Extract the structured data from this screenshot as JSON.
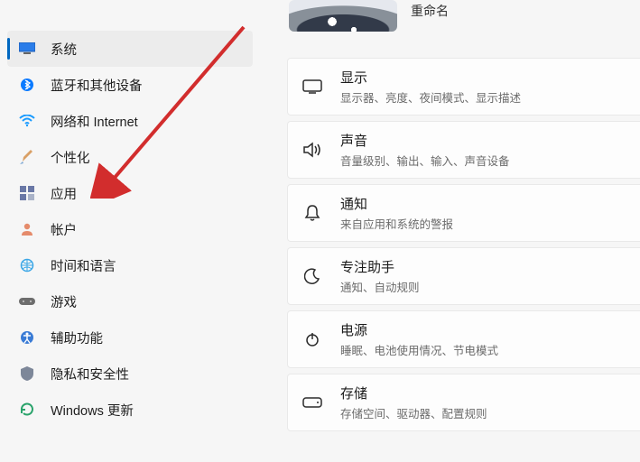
{
  "device": {
    "name": "",
    "rename_label": "重命名"
  },
  "sidebar": {
    "items": [
      {
        "label": "系统"
      },
      {
        "label": "蓝牙和其他设备"
      },
      {
        "label": "网络和 Internet"
      },
      {
        "label": "个性化"
      },
      {
        "label": "应用"
      },
      {
        "label": "帐户"
      },
      {
        "label": "时间和语言"
      },
      {
        "label": "游戏"
      },
      {
        "label": "辅助功能"
      },
      {
        "label": "隐私和安全性"
      },
      {
        "label": "Windows 更新"
      }
    ]
  },
  "main": {
    "cards": [
      {
        "title": "显示",
        "sub": "显示器、亮度、夜间模式、显示描述"
      },
      {
        "title": "声音",
        "sub": "音量级别、输出、输入、声音设备"
      },
      {
        "title": "通知",
        "sub": "来自应用和系统的警报"
      },
      {
        "title": "专注助手",
        "sub": "通知、自动规则"
      },
      {
        "title": "电源",
        "sub": "睡眠、电池使用情况、节电模式"
      },
      {
        "title": "存储",
        "sub": "存储空间、驱动器、配置规则"
      }
    ]
  },
  "colors": {
    "accent": "#0067c0",
    "arrow": "#d22d2d"
  }
}
